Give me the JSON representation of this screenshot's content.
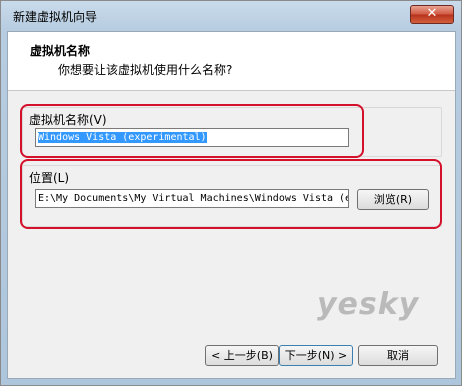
{
  "window": {
    "title": "新建虚拟机向导",
    "close_symbol": "✕"
  },
  "header": {
    "title": "虚拟机名称",
    "subtitle": "你想要让该虚拟机使用什么名称?"
  },
  "name_group": {
    "label": "虚拟机名称(V)",
    "value": "Windows Vista (experimental)"
  },
  "location_group": {
    "label": "位置(L)",
    "value": "E:\\My Documents\\My Virtual Machines\\Windows Vista (e",
    "browse_label": "浏览(R)"
  },
  "footer": {
    "back_label": "< 上一步(B)",
    "next_label": "下一步(N) >",
    "cancel_label": "取消"
  },
  "watermark": "yesky",
  "colors": {
    "highlight": "#d4102a",
    "selection": "#3399ff"
  }
}
